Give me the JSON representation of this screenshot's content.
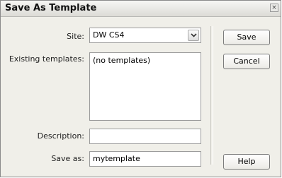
{
  "dialog": {
    "title": "Save As Template",
    "close_glyph": "×"
  },
  "form": {
    "site_label": "Site:",
    "site_value": "DW CS4",
    "existing_label": "Existing templates:",
    "existing_items": [
      "(no templates)"
    ],
    "description_label": "Description:",
    "description_value": "",
    "saveas_label": "Save as:",
    "saveas_value": "mytemplate"
  },
  "buttons": {
    "save": "Save",
    "cancel": "Cancel",
    "help": "Help"
  }
}
